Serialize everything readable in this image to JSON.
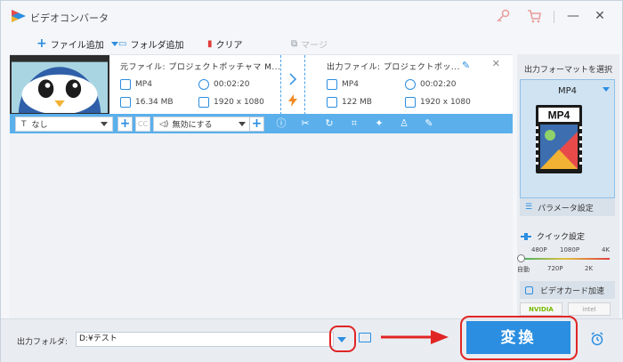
{
  "app": {
    "title": "ビデオコンバータ"
  },
  "toolbar": {
    "add_file": "ファイル追加",
    "add_folder": "フォルダ追加",
    "clear": "クリア",
    "merge": "マージ"
  },
  "file": {
    "source_name": "元ファイル: プロジェクトポッチャマ M...",
    "output_name": "出力ファイル: プロジェクトポッ...",
    "source_format": "MP4",
    "source_duration": "00:02:20",
    "source_size": "16.34 MB",
    "source_resolution": "1920 x 1080",
    "output_format": "MP4",
    "output_duration": "00:02:20",
    "output_size": "122 MB",
    "output_resolution": "1920 x 1080"
  },
  "edit_bar": {
    "subtitle_value": "なし",
    "audio_value": "無効にする"
  },
  "right_panel": {
    "title": "出力フォーマットを選択",
    "format": "MP4",
    "format_art_label": "MP4",
    "param_button": "パラメータ設定",
    "quick_label": "クイック設定",
    "quick_top": [
      "480P",
      "1080P",
      "4K"
    ],
    "quick_bottom": [
      "自動",
      "720P",
      "2K"
    ],
    "gpu_button": "ビデオカード加速",
    "vendors": [
      "NVIDIA",
      "intel"
    ]
  },
  "bottom": {
    "output_folder_label": "出力フォルダ:",
    "output_folder_value": "D:¥テスト",
    "convert_button": "変換"
  },
  "colors": {
    "accent": "#2b8ee0",
    "highlight_red": "#e12525",
    "edit_bar": "#5bb0ec"
  }
}
